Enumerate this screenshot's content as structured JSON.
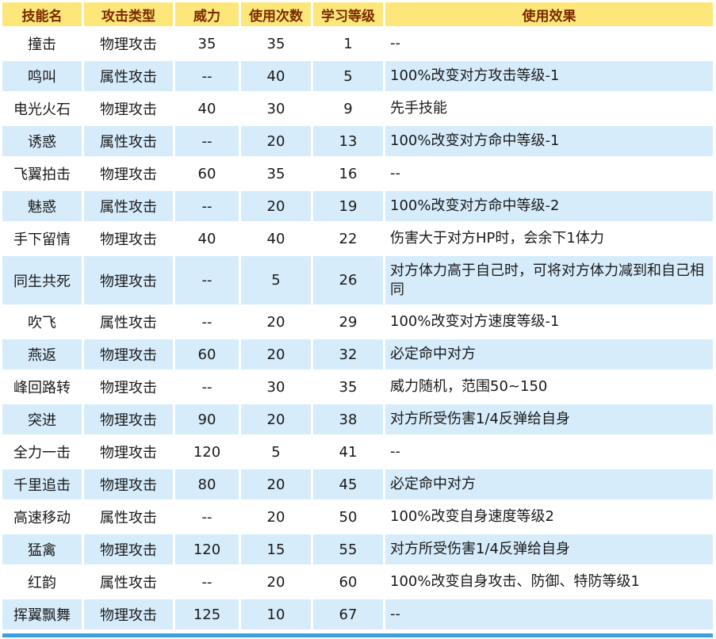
{
  "headers": [
    "技能名",
    "攻击类型",
    "威力",
    "使用次数",
    "学习等级",
    "使用效果"
  ],
  "rows": [
    {
      "name": "撞击",
      "type": "物理攻击",
      "power": "35",
      "pp": "35",
      "level": "1",
      "effect": "--"
    },
    {
      "name": "鸣叫",
      "type": "属性攻击",
      "power": "--",
      "pp": "40",
      "level": "5",
      "effect": "100%改变对方攻击等级-1"
    },
    {
      "name": "电光火石",
      "type": "物理攻击",
      "power": "40",
      "pp": "30",
      "level": "9",
      "effect": "先手技能"
    },
    {
      "name": "诱惑",
      "type": "属性攻击",
      "power": "--",
      "pp": "20",
      "level": "13",
      "effect": "100%改变对方命中等级-1"
    },
    {
      "name": "飞翼拍击",
      "type": "物理攻击",
      "power": "60",
      "pp": "35",
      "level": "16",
      "effect": "--"
    },
    {
      "name": "魅惑",
      "type": "属性攻击",
      "power": "--",
      "pp": "20",
      "level": "19",
      "effect": "100%改变对方命中等级-2"
    },
    {
      "name": "手下留情",
      "type": "物理攻击",
      "power": "40",
      "pp": "40",
      "level": "22",
      "effect": "伤害大于对方HP时，会余下1体力"
    },
    {
      "name": "同生共死",
      "type": "物理攻击",
      "power": "--",
      "pp": "5",
      "level": "26",
      "effect": "对方体力高于自己时，可将对方体力减到和自己相同"
    },
    {
      "name": "吹飞",
      "type": "属性攻击",
      "power": "--",
      "pp": "20",
      "level": "29",
      "effect": "100%改变对方速度等级-1"
    },
    {
      "name": "燕返",
      "type": "物理攻击",
      "power": "60",
      "pp": "20",
      "level": "32",
      "effect": "必定命中对方"
    },
    {
      "name": "峰回路转",
      "type": "物理攻击",
      "power": "--",
      "pp": "30",
      "level": "35",
      "effect": "威力随机，范围50~150"
    },
    {
      "name": "突进",
      "type": "物理攻击",
      "power": "90",
      "pp": "20",
      "level": "38",
      "effect": "对方所受伤害1/4反弹给自身"
    },
    {
      "name": "全力一击",
      "type": "物理攻击",
      "power": "120",
      "pp": "5",
      "level": "41",
      "effect": "--"
    },
    {
      "name": "千里追击",
      "type": "物理攻击",
      "power": "80",
      "pp": "20",
      "level": "45",
      "effect": "必定命中对方"
    },
    {
      "name": "高速移动",
      "type": "属性攻击",
      "power": "--",
      "pp": "20",
      "level": "50",
      "effect": "100%改变自身速度等级2"
    },
    {
      "name": "猛禽",
      "type": "物理攻击",
      "power": "120",
      "pp": "15",
      "level": "55",
      "effect": "对方所受伤害1/4反弹给自身"
    },
    {
      "name": "红韵",
      "type": "属性攻击",
      "power": "--",
      "pp": "20",
      "level": "60",
      "effect": "100%改变自身攻击、防御、特防等级1"
    },
    {
      "name": "挥翼飘舞",
      "type": "物理攻击",
      "power": "125",
      "pp": "10",
      "level": "67",
      "effect": "--"
    }
  ],
  "colors": {
    "header_bg": "#fde67a",
    "header_text": "#7a2a00",
    "row_alt_bg": "#d6ecfb",
    "bottom_bar": "#3aa0e0"
  }
}
